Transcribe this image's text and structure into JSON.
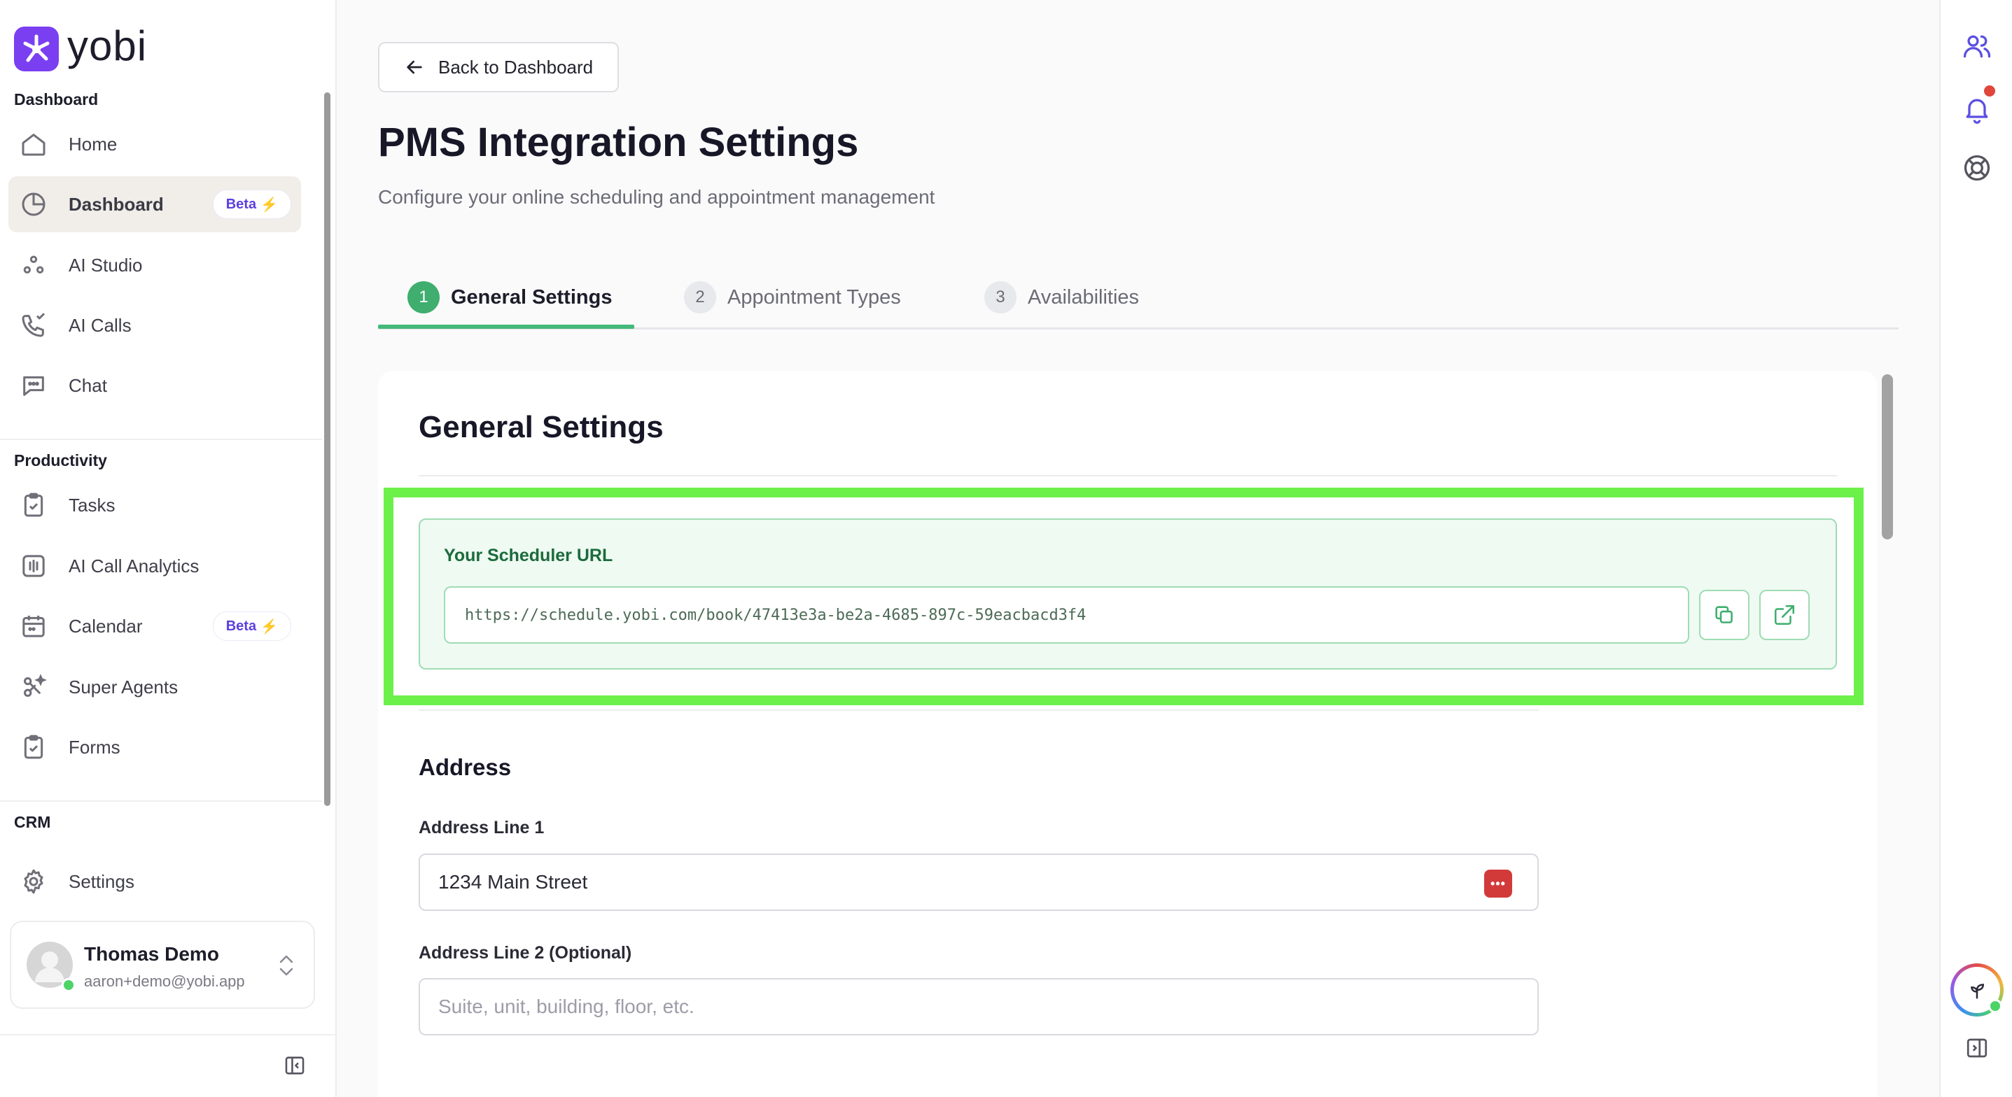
{
  "brand": {
    "name": "yobi",
    "accent": "#7b3ff2"
  },
  "sidebar": {
    "sections": [
      {
        "label": "Dashboard"
      },
      {
        "label": "Productivity"
      },
      {
        "label": "CRM"
      }
    ],
    "items": [
      {
        "label": "Home",
        "icon": "home-icon"
      },
      {
        "label": "Dashboard",
        "icon": "pie-chart-icon",
        "badge": "Beta",
        "active": true
      },
      {
        "label": "AI Studio",
        "icon": "ai-studio-icon"
      },
      {
        "label": "AI Calls",
        "icon": "phone-icon"
      },
      {
        "label": "Chat",
        "icon": "chat-icon"
      },
      {
        "label": "Tasks",
        "icon": "clipboard-check-icon"
      },
      {
        "label": "AI Call Analytics",
        "icon": "analytics-icon"
      },
      {
        "label": "Calendar",
        "icon": "calendar-icon",
        "badge": "Beta"
      },
      {
        "label": "Super Agents",
        "icon": "super-agents-icon"
      },
      {
        "label": "Forms",
        "icon": "forms-icon"
      },
      {
        "label": "Settings",
        "icon": "gear-icon"
      }
    ],
    "user": {
      "name": "Thomas Demo",
      "email": "aaron+demo@yobi.app"
    }
  },
  "header": {
    "back_label": "Back to Dashboard",
    "title": "PMS Integration Settings",
    "subtitle": "Configure your online scheduling and appointment management"
  },
  "tabs": [
    {
      "num": "1",
      "label": "General Settings",
      "active": true
    },
    {
      "num": "2",
      "label": "Appointment Types"
    },
    {
      "num": "3",
      "label": "Availabilities"
    }
  ],
  "card": {
    "title": "General Settings",
    "scheduler": {
      "label": "Your Scheduler URL",
      "url": "https://schedule.yobi.com/book/47413e3a-be2a-4685-897c-59eacbacd3f4"
    },
    "address": {
      "title": "Address",
      "line1_label": "Address Line 1",
      "line1_value": "1234 Main Street",
      "line2_label": "Address Line 2 (Optional)",
      "line2_placeholder": "Suite, unit, building, floor, etc."
    }
  },
  "colors": {
    "success": "#3fae6e",
    "highlight": "#6cf04a",
    "notification": "#e0463b"
  }
}
